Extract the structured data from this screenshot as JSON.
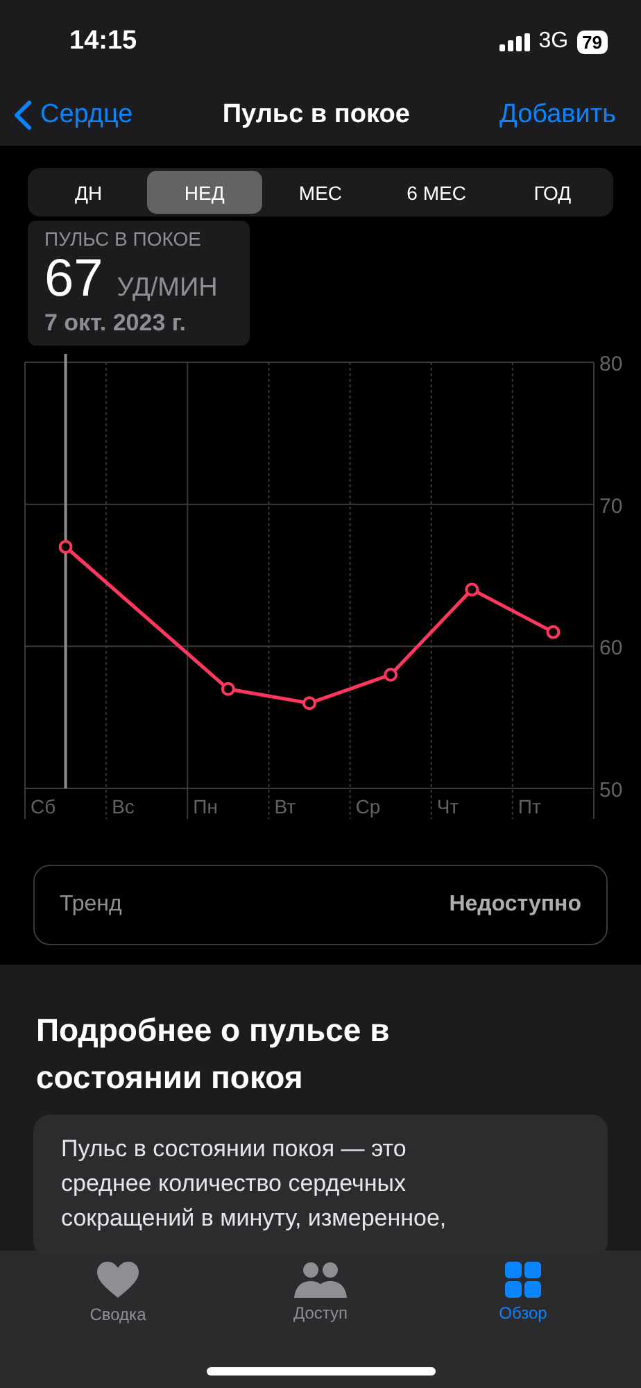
{
  "status_bar": {
    "time": "14:15",
    "network": "3G",
    "battery": "79"
  },
  "nav": {
    "back": "Сердце",
    "title": "Пульс в покое",
    "action": "Добавить"
  },
  "tabs": [
    {
      "label": "ДН",
      "selected": false
    },
    {
      "label": "НЕД",
      "selected": true
    },
    {
      "label": "МЕС",
      "selected": false
    },
    {
      "label": "6 МЕС",
      "selected": false
    },
    {
      "label": "ГОД",
      "selected": false
    }
  ],
  "callout": {
    "label": "ПУЛЬС В ПОКОЕ",
    "value": "67",
    "unit": "УД/МИН",
    "date": "7 окт. 2023 г."
  },
  "chart": {
    "chart_data": {
      "type": "line",
      "categories": [
        "Сб",
        "Вс",
        "Пн",
        "Вт",
        "Ср",
        "Чт",
        "Пт"
      ],
      "series": [
        {
          "color": "#ff375f",
          "marker": "circle",
          "values": [
            67,
            null,
            57,
            56,
            58,
            64,
            61
          ]
        }
      ],
      "ref_lines": [
        {
          "axis": "x",
          "value": "Сб",
          "color": "#8e8e93"
        }
      ],
      "ylim": [
        50,
        80
      ],
      "yticks": [
        50,
        60,
        70,
        80
      ]
    }
  },
  "trend": {
    "label": "Тренд",
    "value": "Недоступно"
  },
  "about": {
    "heading": "Подробнее о пульсе в состоянии покоя",
    "text": "Пульс в состоянии покоя — это среднее количество сердечных сокращений в минуту, измеренное,"
  },
  "tab_bar": [
    {
      "label": "Сводка",
      "kind": "heart",
      "selected": false
    },
    {
      "label": "Доступ",
      "kind": "people",
      "selected": false
    },
    {
      "label": "Обзор",
      "kind": "grid",
      "selected": true
    }
  ]
}
